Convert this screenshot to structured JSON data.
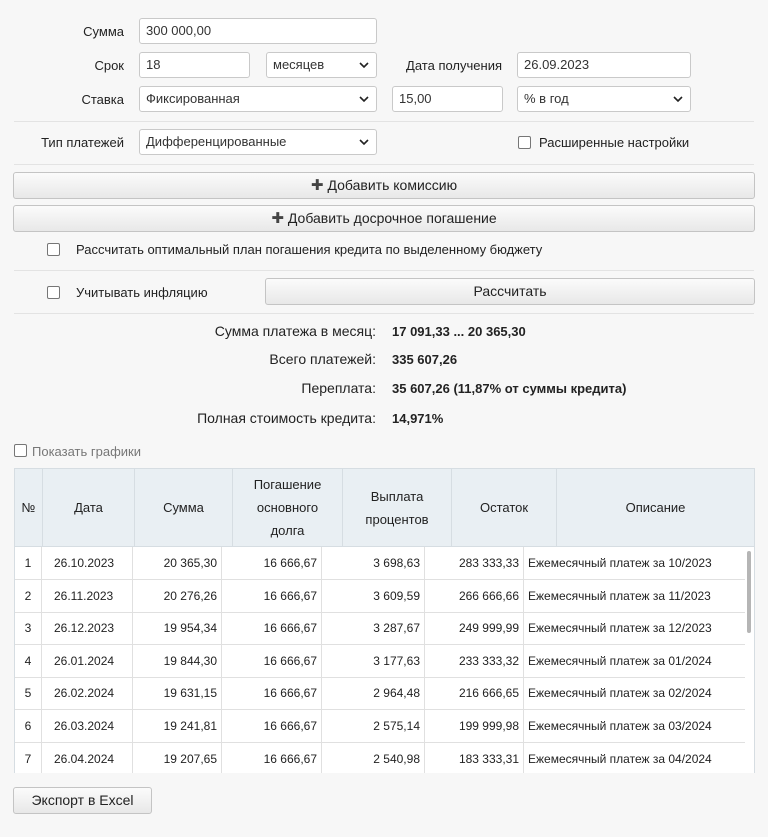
{
  "form": {
    "amount_label": "Сумма",
    "amount_value": "300 000,00",
    "term_label": "Срок",
    "term_value": "18",
    "term_unit": "месяцев",
    "date_label": "Дата получения",
    "date_value": "26.09.2023",
    "rate_label": "Ставка",
    "rate_type": "Фиксированная",
    "rate_value": "15,00",
    "rate_unit": "% в год",
    "payment_type_label": "Тип платежей",
    "payment_type": "Дифференцированные",
    "advanced_label": "Расширенные настройки",
    "advanced_checked": false
  },
  "buttons": {
    "add_commission": "Добавить комиссию",
    "add_prepayment": "Добавить досрочное погашение",
    "calculate": "Рассчитать",
    "export": "Экспорт в Excel"
  },
  "options": {
    "optimal_plan_label": "Рассчитать оптимальный план погашения кредита по выделенному бюджету",
    "optimal_plan_checked": false,
    "inflation_label": "Учитывать инфляцию",
    "inflation_checked": false
  },
  "results": {
    "monthly_label": "Сумма платежа в месяц:",
    "monthly_value": "17 091,33 ... 20 365,30",
    "total_label": "Всего платежей:",
    "total_value": "335 607,26",
    "overpay_label": "Переплата:",
    "overpay_value": "35 607,26 (11,87% от суммы кредита)",
    "full_cost_label": "Полная стоимость кредита:",
    "full_cost_value": "14,971%"
  },
  "show_charts_label": "Показать графики",
  "table": {
    "headers": {
      "num": "№",
      "date": "Дата",
      "sum": "Сумма",
      "principal_1": "Погашение",
      "principal_2": "основного",
      "principal_3": "долга",
      "interest_1": "Выплата",
      "interest_2": "процентов",
      "balance": "Остаток",
      "description": "Описание"
    },
    "rows": [
      {
        "n": "1",
        "date": "26.10.2023",
        "sum": "20 365,30",
        "principal": "16 666,67",
        "interest": "3 698,63",
        "balance": "283 333,33",
        "desc": "Ежемесячный платеж за 10/2023"
      },
      {
        "n": "2",
        "date": "26.11.2023",
        "sum": "20 276,26",
        "principal": "16 666,67",
        "interest": "3 609,59",
        "balance": "266 666,66",
        "desc": "Ежемесячный платеж за 11/2023"
      },
      {
        "n": "3",
        "date": "26.12.2023",
        "sum": "19 954,34",
        "principal": "16 666,67",
        "interest": "3 287,67",
        "balance": "249 999,99",
        "desc": "Ежемесячный платеж за 12/2023"
      },
      {
        "n": "4",
        "date": "26.01.2024",
        "sum": "19 844,30",
        "principal": "16 666,67",
        "interest": "3 177,63",
        "balance": "233 333,32",
        "desc": "Ежемесячный платеж за 01/2024"
      },
      {
        "n": "5",
        "date": "26.02.2024",
        "sum": "19 631,15",
        "principal": "16 666,67",
        "interest": "2 964,48",
        "balance": "216 666,65",
        "desc": "Ежемесячный платеж за 02/2024"
      },
      {
        "n": "6",
        "date": "26.03.2024",
        "sum": "19 241,81",
        "principal": "16 666,67",
        "interest": "2 575,14",
        "balance": "199 999,98",
        "desc": "Ежемесячный платеж за 03/2024"
      },
      {
        "n": "7",
        "date": "26.04.2024",
        "sum": "19 207,65",
        "principal": "16 666,67",
        "interest": "2 540,98",
        "balance": "183 333,31",
        "desc": "Ежемесячный платеж за 04/2024"
      }
    ]
  }
}
